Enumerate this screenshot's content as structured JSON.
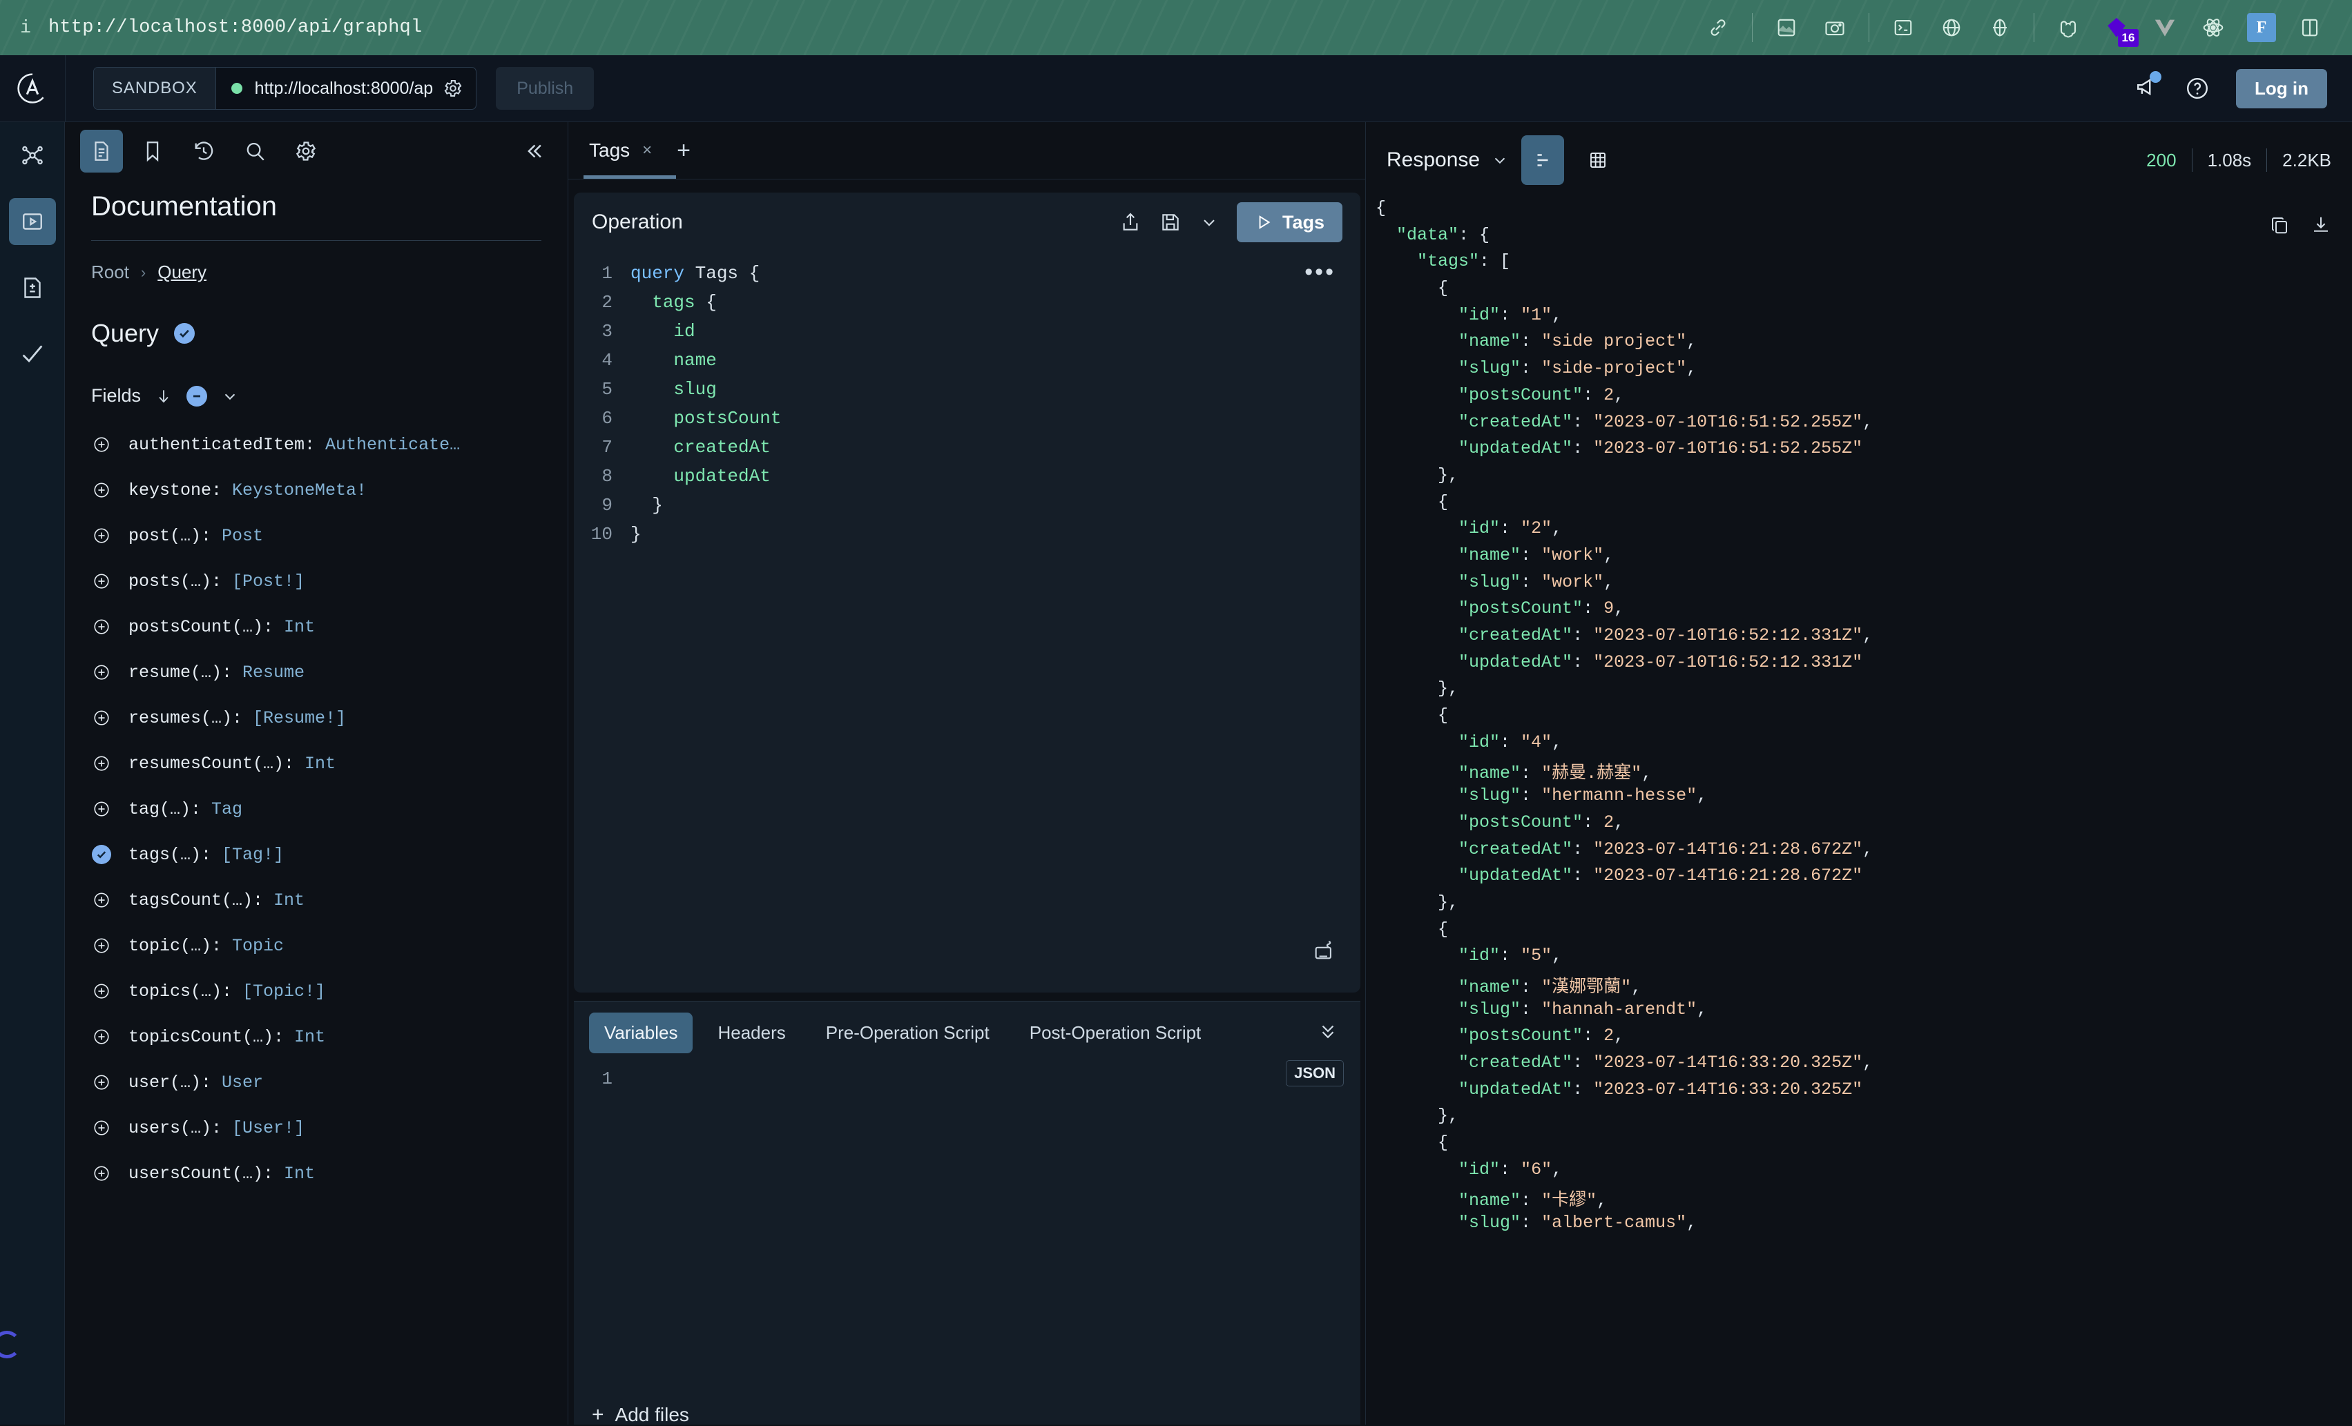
{
  "browser": {
    "url": "http://localhost:8000/api/graphql",
    "info_icon": "info-icon",
    "icons": [
      "link-icon",
      "image-capture-icon",
      "camera-icon",
      "terminal-icon",
      "globe-icon",
      "target-icon",
      "cookie-icon",
      "gatsby-icon",
      "vue-icon",
      "react-icon",
      "font-icon",
      "split-view-icon"
    ],
    "badge_count": "16"
  },
  "header": {
    "logo": "apollo-logo",
    "sandbox_label": "SANDBOX",
    "endpoint_url": "http://localhost:8000/ap",
    "endpoint_full": "http://localhost:8000/api/graphql",
    "connection_status": "connected",
    "settings_icon": "gear-icon",
    "publish_label": "Publish",
    "megaphone_icon": "megaphone-icon",
    "help_icon": "help-circle-icon",
    "login_label": "Log in"
  },
  "rail": {
    "items": [
      {
        "icon": "schema-graph-icon",
        "active": false
      },
      {
        "icon": "explorer-play-icon",
        "active": true
      },
      {
        "icon": "file-diff-icon",
        "active": false
      },
      {
        "icon": "checkmark-icon",
        "active": false
      }
    ]
  },
  "doc": {
    "toolbar": [
      {
        "icon": "documentation-icon",
        "active": true
      },
      {
        "icon": "bookmark-icon",
        "active": false
      },
      {
        "icon": "history-icon",
        "active": false
      },
      {
        "icon": "search-icon",
        "active": false
      },
      {
        "icon": "gear-icon",
        "active": false
      }
    ],
    "collapse_icon": "chevrons-left-icon",
    "title": "Documentation",
    "breadcrumb": {
      "root": "Root",
      "separator": "›",
      "current": "Query"
    },
    "type_name": "Query",
    "fields_label": "Fields",
    "fields": [
      {
        "name": "authenticatedItem: ",
        "type": "Authenticate…",
        "selected": false
      },
      {
        "name": "keystone: ",
        "type": "KeystoneMeta!",
        "selected": false
      },
      {
        "name": "post(…): ",
        "type": "Post",
        "selected": false
      },
      {
        "name": "posts(…): ",
        "type": "[Post!]",
        "selected": false
      },
      {
        "name": "postsCount(…): ",
        "type": "Int",
        "selected": false
      },
      {
        "name": "resume(…): ",
        "type": "Resume",
        "selected": false
      },
      {
        "name": "resumes(…): ",
        "type": "[Resume!]",
        "selected": false
      },
      {
        "name": "resumesCount(…): ",
        "type": "Int",
        "selected": false
      },
      {
        "name": "tag(…): ",
        "type": "Tag",
        "selected": false
      },
      {
        "name": "tags(…): ",
        "type": "[Tag!]",
        "selected": true
      },
      {
        "name": "tagsCount(…): ",
        "type": "Int",
        "selected": false
      },
      {
        "name": "topic(…): ",
        "type": "Topic",
        "selected": false
      },
      {
        "name": "topics(…): ",
        "type": "[Topic!]",
        "selected": false
      },
      {
        "name": "topicsCount(…): ",
        "type": "Int",
        "selected": false
      },
      {
        "name": "user(…): ",
        "type": "User",
        "selected": false
      },
      {
        "name": "users(…): ",
        "type": "[User!]",
        "selected": false
      },
      {
        "name": "usersCount(…): ",
        "type": "Int",
        "selected": false
      }
    ]
  },
  "tabs": {
    "items": [
      {
        "label": "Tags",
        "close": "×",
        "active": true
      }
    ],
    "add_label": "+"
  },
  "operation": {
    "title": "Operation",
    "share_icon": "share-icon",
    "save_icon": "save-icon",
    "chevron_icon": "chevron-down-icon",
    "run_label": "Tags",
    "run_icon": "play-icon",
    "menu_icon": "more-horizontal-icon",
    "keyboard_icon": "keyboard-icon",
    "code_lines": [
      {
        "n": "1",
        "indent": 0,
        "kw": "query",
        "name": " Tags ",
        "punc": "{"
      },
      {
        "n": "2",
        "indent": 1,
        "kw": "",
        "name": "tags ",
        "punc": "{"
      },
      {
        "n": "3",
        "indent": 2,
        "kw": "",
        "name": "id",
        "punc": ""
      },
      {
        "n": "4",
        "indent": 2,
        "kw": "",
        "name": "name",
        "punc": ""
      },
      {
        "n": "5",
        "indent": 2,
        "kw": "",
        "name": "slug",
        "punc": ""
      },
      {
        "n": "6",
        "indent": 2,
        "kw": "",
        "name": "postsCount",
        "punc": ""
      },
      {
        "n": "7",
        "indent": 2,
        "kw": "",
        "name": "createdAt",
        "punc": ""
      },
      {
        "n": "8",
        "indent": 2,
        "kw": "",
        "name": "updatedAt",
        "punc": ""
      },
      {
        "n": "9",
        "indent": 1,
        "kw": "",
        "name": "",
        "punc": "}"
      },
      {
        "n": "10",
        "indent": 0,
        "kw": "",
        "name": "",
        "punc": "}"
      }
    ]
  },
  "variables": {
    "tabs": [
      {
        "label": "Variables",
        "active": true
      },
      {
        "label": "Headers",
        "active": false
      },
      {
        "label": "Pre-Operation Script",
        "active": false
      },
      {
        "label": "Post-Operation Script",
        "active": false
      }
    ],
    "collapse_icon": "chevrons-down-icon",
    "line_number": "1",
    "content": "",
    "format_badge": "JSON",
    "add_files_label": "Add files",
    "add_files_icon": "plus-icon"
  },
  "response": {
    "title": "Response",
    "chevron_icon": "chevron-down-icon",
    "view_modes": [
      {
        "icon": "json-view-icon",
        "active": true
      },
      {
        "icon": "table-view-icon",
        "active": false
      }
    ],
    "status": "200",
    "time": "1.08s",
    "size": "2.2KB",
    "copy_icon": "copy-icon",
    "download_icon": "download-icon",
    "json_lines": [
      {
        "indent": 0,
        "parts": [
          {
            "t": "punc",
            "v": "{"
          }
        ]
      },
      {
        "indent": 1,
        "parts": [
          {
            "t": "key",
            "v": "\"data\""
          },
          {
            "t": "punc",
            "v": ": {"
          }
        ]
      },
      {
        "indent": 2,
        "parts": [
          {
            "t": "key",
            "v": "\"tags\""
          },
          {
            "t": "punc",
            "v": ": ["
          }
        ]
      },
      {
        "indent": 3,
        "parts": [
          {
            "t": "punc",
            "v": "{"
          }
        ]
      },
      {
        "indent": 4,
        "parts": [
          {
            "t": "key",
            "v": "\"id\""
          },
          {
            "t": "punc",
            "v": ": "
          },
          {
            "t": "str",
            "v": "\"1\""
          },
          {
            "t": "punc",
            "v": ","
          }
        ]
      },
      {
        "indent": 4,
        "parts": [
          {
            "t": "key",
            "v": "\"name\""
          },
          {
            "t": "punc",
            "v": ": "
          },
          {
            "t": "str",
            "v": "\"side project\""
          },
          {
            "t": "punc",
            "v": ","
          }
        ]
      },
      {
        "indent": 4,
        "parts": [
          {
            "t": "key",
            "v": "\"slug\""
          },
          {
            "t": "punc",
            "v": ": "
          },
          {
            "t": "str",
            "v": "\"side-project\""
          },
          {
            "t": "punc",
            "v": ","
          }
        ]
      },
      {
        "indent": 4,
        "parts": [
          {
            "t": "key",
            "v": "\"postsCount\""
          },
          {
            "t": "punc",
            "v": ": "
          },
          {
            "t": "num",
            "v": "2"
          },
          {
            "t": "punc",
            "v": ","
          }
        ]
      },
      {
        "indent": 4,
        "parts": [
          {
            "t": "key",
            "v": "\"createdAt\""
          },
          {
            "t": "punc",
            "v": ": "
          },
          {
            "t": "str",
            "v": "\"2023-07-10T16:51:52.255Z\""
          },
          {
            "t": "punc",
            "v": ","
          }
        ]
      },
      {
        "indent": 4,
        "parts": [
          {
            "t": "key",
            "v": "\"updatedAt\""
          },
          {
            "t": "punc",
            "v": ": "
          },
          {
            "t": "str",
            "v": "\"2023-07-10T16:51:52.255Z\""
          }
        ]
      },
      {
        "indent": 3,
        "parts": [
          {
            "t": "punc",
            "v": "},"
          }
        ]
      },
      {
        "indent": 3,
        "parts": [
          {
            "t": "punc",
            "v": "{"
          }
        ]
      },
      {
        "indent": 4,
        "parts": [
          {
            "t": "key",
            "v": "\"id\""
          },
          {
            "t": "punc",
            "v": ": "
          },
          {
            "t": "str",
            "v": "\"2\""
          },
          {
            "t": "punc",
            "v": ","
          }
        ]
      },
      {
        "indent": 4,
        "parts": [
          {
            "t": "key",
            "v": "\"name\""
          },
          {
            "t": "punc",
            "v": ": "
          },
          {
            "t": "str",
            "v": "\"work\""
          },
          {
            "t": "punc",
            "v": ","
          }
        ]
      },
      {
        "indent": 4,
        "parts": [
          {
            "t": "key",
            "v": "\"slug\""
          },
          {
            "t": "punc",
            "v": ": "
          },
          {
            "t": "str",
            "v": "\"work\""
          },
          {
            "t": "punc",
            "v": ","
          }
        ]
      },
      {
        "indent": 4,
        "parts": [
          {
            "t": "key",
            "v": "\"postsCount\""
          },
          {
            "t": "punc",
            "v": ": "
          },
          {
            "t": "num",
            "v": "9"
          },
          {
            "t": "punc",
            "v": ","
          }
        ]
      },
      {
        "indent": 4,
        "parts": [
          {
            "t": "key",
            "v": "\"createdAt\""
          },
          {
            "t": "punc",
            "v": ": "
          },
          {
            "t": "str",
            "v": "\"2023-07-10T16:52:12.331Z\""
          },
          {
            "t": "punc",
            "v": ","
          }
        ]
      },
      {
        "indent": 4,
        "parts": [
          {
            "t": "key",
            "v": "\"updatedAt\""
          },
          {
            "t": "punc",
            "v": ": "
          },
          {
            "t": "str",
            "v": "\"2023-07-10T16:52:12.331Z\""
          }
        ]
      },
      {
        "indent": 3,
        "parts": [
          {
            "t": "punc",
            "v": "},"
          }
        ]
      },
      {
        "indent": 3,
        "parts": [
          {
            "t": "punc",
            "v": "{"
          }
        ]
      },
      {
        "indent": 4,
        "parts": [
          {
            "t": "key",
            "v": "\"id\""
          },
          {
            "t": "punc",
            "v": ": "
          },
          {
            "t": "str",
            "v": "\"4\""
          },
          {
            "t": "punc",
            "v": ","
          }
        ]
      },
      {
        "indent": 4,
        "parts": [
          {
            "t": "key",
            "v": "\"name\""
          },
          {
            "t": "punc",
            "v": ": "
          },
          {
            "t": "str",
            "v": "\"赫曼.赫塞\""
          },
          {
            "t": "punc",
            "v": ","
          }
        ]
      },
      {
        "indent": 4,
        "parts": [
          {
            "t": "key",
            "v": "\"slug\""
          },
          {
            "t": "punc",
            "v": ": "
          },
          {
            "t": "str",
            "v": "\"hermann-hesse\""
          },
          {
            "t": "punc",
            "v": ","
          }
        ]
      },
      {
        "indent": 4,
        "parts": [
          {
            "t": "key",
            "v": "\"postsCount\""
          },
          {
            "t": "punc",
            "v": ": "
          },
          {
            "t": "num",
            "v": "2"
          },
          {
            "t": "punc",
            "v": ","
          }
        ]
      },
      {
        "indent": 4,
        "parts": [
          {
            "t": "key",
            "v": "\"createdAt\""
          },
          {
            "t": "punc",
            "v": ": "
          },
          {
            "t": "str",
            "v": "\"2023-07-14T16:21:28.672Z\""
          },
          {
            "t": "punc",
            "v": ","
          }
        ]
      },
      {
        "indent": 4,
        "parts": [
          {
            "t": "key",
            "v": "\"updatedAt\""
          },
          {
            "t": "punc",
            "v": ": "
          },
          {
            "t": "str",
            "v": "\"2023-07-14T16:21:28.672Z\""
          }
        ]
      },
      {
        "indent": 3,
        "parts": [
          {
            "t": "punc",
            "v": "},"
          }
        ]
      },
      {
        "indent": 3,
        "parts": [
          {
            "t": "punc",
            "v": "{"
          }
        ]
      },
      {
        "indent": 4,
        "parts": [
          {
            "t": "key",
            "v": "\"id\""
          },
          {
            "t": "punc",
            "v": ": "
          },
          {
            "t": "str",
            "v": "\"5\""
          },
          {
            "t": "punc",
            "v": ","
          }
        ]
      },
      {
        "indent": 4,
        "parts": [
          {
            "t": "key",
            "v": "\"name\""
          },
          {
            "t": "punc",
            "v": ": "
          },
          {
            "t": "str",
            "v": "\"漢娜鄂蘭\""
          },
          {
            "t": "punc",
            "v": ","
          }
        ]
      },
      {
        "indent": 4,
        "parts": [
          {
            "t": "key",
            "v": "\"slug\""
          },
          {
            "t": "punc",
            "v": ": "
          },
          {
            "t": "str",
            "v": "\"hannah-arendt\""
          },
          {
            "t": "punc",
            "v": ","
          }
        ]
      },
      {
        "indent": 4,
        "parts": [
          {
            "t": "key",
            "v": "\"postsCount\""
          },
          {
            "t": "punc",
            "v": ": "
          },
          {
            "t": "num",
            "v": "2"
          },
          {
            "t": "punc",
            "v": ","
          }
        ]
      },
      {
        "indent": 4,
        "parts": [
          {
            "t": "key",
            "v": "\"createdAt\""
          },
          {
            "t": "punc",
            "v": ": "
          },
          {
            "t": "str",
            "v": "\"2023-07-14T16:33:20.325Z\""
          },
          {
            "t": "punc",
            "v": ","
          }
        ]
      },
      {
        "indent": 4,
        "parts": [
          {
            "t": "key",
            "v": "\"updatedAt\""
          },
          {
            "t": "punc",
            "v": ": "
          },
          {
            "t": "str",
            "v": "\"2023-07-14T16:33:20.325Z\""
          }
        ]
      },
      {
        "indent": 3,
        "parts": [
          {
            "t": "punc",
            "v": "},"
          }
        ]
      },
      {
        "indent": 3,
        "parts": [
          {
            "t": "punc",
            "v": "{"
          }
        ]
      },
      {
        "indent": 4,
        "parts": [
          {
            "t": "key",
            "v": "\"id\""
          },
          {
            "t": "punc",
            "v": ": "
          },
          {
            "t": "str",
            "v": "\"6\""
          },
          {
            "t": "punc",
            "v": ","
          }
        ]
      },
      {
        "indent": 4,
        "parts": [
          {
            "t": "key",
            "v": "\"name\""
          },
          {
            "t": "punc",
            "v": ": "
          },
          {
            "t": "str",
            "v": "\"卡繆\""
          },
          {
            "t": "punc",
            "v": ","
          }
        ]
      },
      {
        "indent": 4,
        "parts": [
          {
            "t": "key",
            "v": "\"slug\""
          },
          {
            "t": "punc",
            "v": ": "
          },
          {
            "t": "str",
            "v": "\"albert-camus\""
          },
          {
            "t": "punc",
            "v": ","
          }
        ]
      }
    ]
  }
}
